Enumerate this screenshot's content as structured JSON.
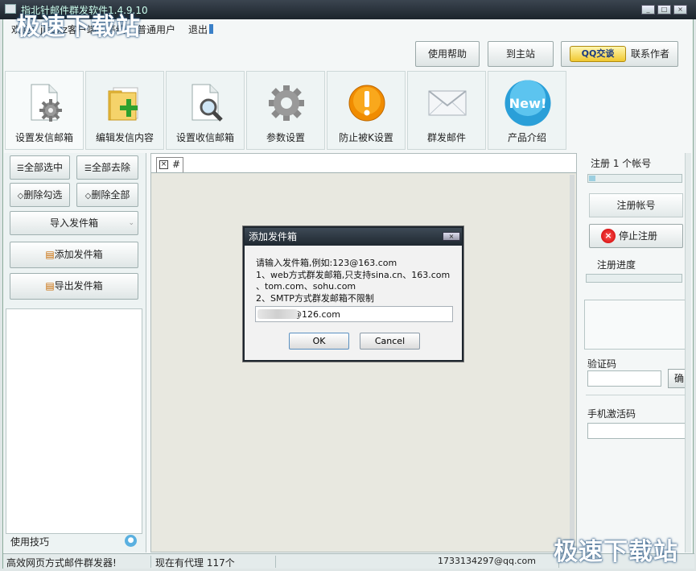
{
  "window": {
    "title": "指北针邮件群发软件1.4.9.10",
    "watermark": "极速下载站"
  },
  "header": {
    "welcome": "欢迎：jisuxz客户端，等级",
    "user_type": "普通用户",
    "logout": "退出",
    "help": "使用帮助",
    "home": "到主站",
    "qq_badge": "QQ交谈",
    "contact": "联系作者"
  },
  "toolbar": [
    {
      "label": "设置发信邮箱",
      "icon": "document-gear-icon"
    },
    {
      "label": "编辑发信内容",
      "icon": "folder-add-icon"
    },
    {
      "label": "设置收信邮箱",
      "icon": "document-search-icon"
    },
    {
      "label": "参数设置",
      "icon": "gear-icon"
    },
    {
      "label": "防止被K设置",
      "icon": "warning-icon"
    },
    {
      "label": "群发邮件",
      "icon": "envelope-icon"
    },
    {
      "label": "产品介绍",
      "icon": "new-badge-icon"
    }
  ],
  "left_panel": {
    "select_all": "全部选中",
    "deselect_all": "全部去除",
    "delete_checked": "删除勾选",
    "delete_all": "删除全部",
    "import": "导入发件箱",
    "add": "添加发件箱",
    "export": "导出发件箱",
    "tips": "使用技巧"
  },
  "tab": {
    "label": "#"
  },
  "dialog": {
    "title": "添加发件箱",
    "line1": "请输入发件箱,例如:123@163.com",
    "line2": "1、web方式群发邮箱,只支持sina.cn、163.com",
    "line3": "、tom.com、sohu.com",
    "line4": "2、SMTP方式群发邮箱不限制",
    "input_value": "            @126.com",
    "ok": "OK",
    "cancel": "Cancel"
  },
  "right_panel": {
    "reg_count": "注册 1 个帐号",
    "reg_account": "注册帐号",
    "stop_reg": "停止注册",
    "reg_progress": "注册进度",
    "captcha": "验证码",
    "confirm": "确",
    "activation": "手机激活码"
  },
  "status": {
    "left": "高效网页方式邮件群发器!",
    "proxies": "现在有代理 117个",
    "email": "1733134297@qq.com"
  },
  "colors": {
    "title_bar": "#1c242c",
    "accent": "#3a80c8",
    "stop": "#cc0000",
    "warning": "#f08c00"
  }
}
